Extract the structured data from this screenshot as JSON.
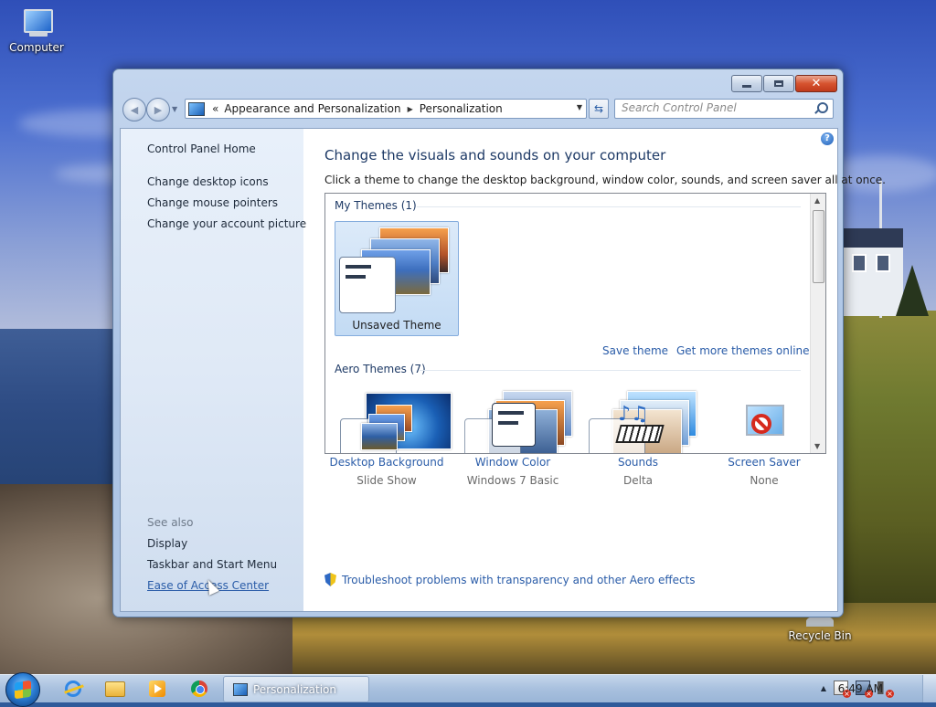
{
  "desktop": {
    "icons": [
      {
        "label": "Computer"
      },
      {
        "label": "Recycle Bin"
      }
    ]
  },
  "window": {
    "title": "Personalization",
    "controls": {
      "minimize": "minimize",
      "maximize": "maximize",
      "close": "close"
    },
    "address_bar": {
      "overflow": "«",
      "crumbs": [
        "Appearance and Personalization",
        "Personalization"
      ]
    },
    "search": {
      "placeholder": "Search Control Panel"
    }
  },
  "left_pane": {
    "home": "Control Panel Home",
    "links": [
      "Change desktop icons",
      "Change mouse pointers",
      "Change your account picture"
    ],
    "see_also": {
      "title": "See also",
      "links": [
        "Display",
        "Taskbar and Start Menu",
        "Ease of Access Center"
      ]
    }
  },
  "main": {
    "heading": "Change the visuals and sounds on your computer",
    "subheading": "Click a theme to change the desktop background, window color, sounds, and screen saver all at once.",
    "themes": {
      "my_themes": {
        "label": "My Themes (1)",
        "items": [
          {
            "name": "Unsaved Theme",
            "selected": true
          }
        ]
      },
      "save_theme": "Save theme",
      "get_more": "Get more themes online",
      "aero_themes": {
        "label": "Aero Themes (7)"
      }
    },
    "bottom": [
      {
        "title": "Desktop Background",
        "value": "Slide Show",
        "icon": "desktop-background-icon"
      },
      {
        "title": "Window Color",
        "value": "Windows 7 Basic",
        "icon": "window-color-icon"
      },
      {
        "title": "Sounds",
        "value": "Delta",
        "icon": "sounds-icon"
      },
      {
        "title": "Screen Saver",
        "value": "None",
        "icon": "screen-saver-icon"
      }
    ],
    "troubleshoot": "Troubleshoot problems with transparency and other Aero effects"
  },
  "taskbar": {
    "active_task": "Personalization",
    "pinned": [
      "internet-explorer-icon",
      "folder-icon",
      "media-player-icon",
      "chrome-icon"
    ],
    "clock": "6:49 AM"
  },
  "colors": {
    "link": "#2a5ca8",
    "heading": "#1e3a66",
    "selected_tile": "#c3dbf4"
  }
}
